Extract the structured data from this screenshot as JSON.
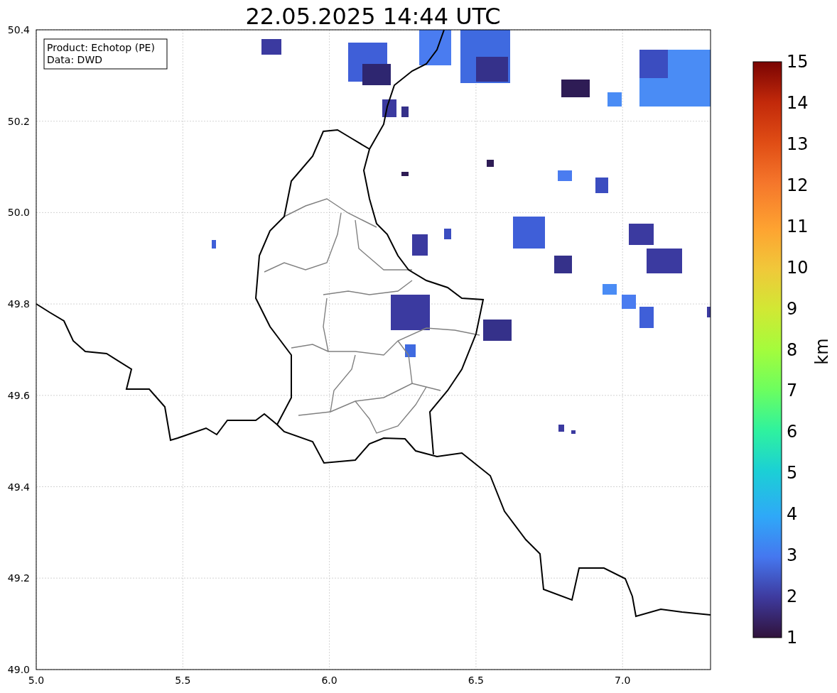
{
  "title": "22.05.2025 14:44 UTC",
  "legend": {
    "lines": [
      "Product: Echotop (PE)",
      "Data: DWD"
    ]
  },
  "x_axis": {
    "ticks": [
      "5.0",
      "5.5",
      "6.0",
      "6.5",
      "7.0"
    ]
  },
  "y_axis": {
    "ticks": [
      "50.4",
      "50.2",
      "50.0",
      "49.8",
      "49.6",
      "49.4",
      "49.2",
      "49.0"
    ]
  },
  "colorbar": {
    "label": "km",
    "ticks": [
      "15",
      "14",
      "13",
      "12",
      "11",
      "10",
      "9",
      "8",
      "7",
      "6",
      "5",
      "4",
      "3",
      "2",
      "1"
    ]
  }
}
